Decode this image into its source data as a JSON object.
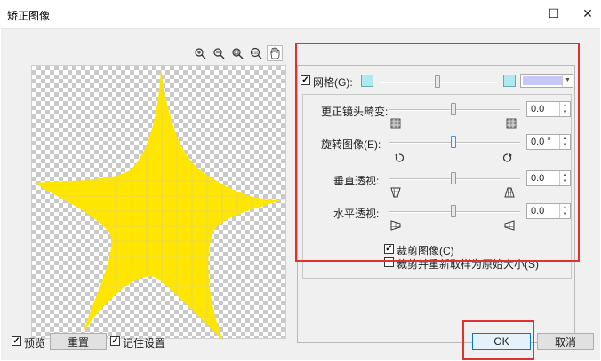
{
  "window": {
    "title": "矫正图像",
    "maximize_glyph": "☐",
    "close_glyph": "✕"
  },
  "zoom_toolbar": {
    "icons": [
      "zoom-in-icon",
      "zoom-out-icon",
      "zoom-fit-icon",
      "zoom-100-icon",
      "pan-hand-icon"
    ]
  },
  "grid": {
    "checked": true,
    "check_glyph": "✓",
    "label": "网格(G):"
  },
  "controls": {
    "lens_distortion": {
      "label": "更正镜头畸变:",
      "value": "0.0"
    },
    "rotate": {
      "label": "旋转图像(E):",
      "value": "0.0 °"
    },
    "vertical_perspective": {
      "label": "垂直透视:",
      "value": "0.0"
    },
    "horizontal_perspective": {
      "label": "水平透视:",
      "value": "0.0"
    }
  },
  "options": {
    "crop_image": {
      "checked": true,
      "check_glyph": "✓",
      "label": "裁剪图像(C)"
    },
    "crop_resample": {
      "checked": false,
      "label": "裁剪并重新取样为原始大小(S)"
    }
  },
  "footer": {
    "preview": {
      "checked": true,
      "check_glyph": "✓",
      "label": "预览"
    },
    "reset_label": "重置",
    "remember": {
      "checked": true,
      "check_glyph": "✓",
      "label": "记住设置"
    },
    "ok_label": "OK",
    "cancel_label": "取消"
  },
  "spin_arrow_up": "▲",
  "spin_arrow_down": "▼",
  "combo_arrow": "▼",
  "colors": {
    "star_fill": "#ffe600",
    "highlight": "#e03131",
    "grid_color": "#aee8f0"
  }
}
